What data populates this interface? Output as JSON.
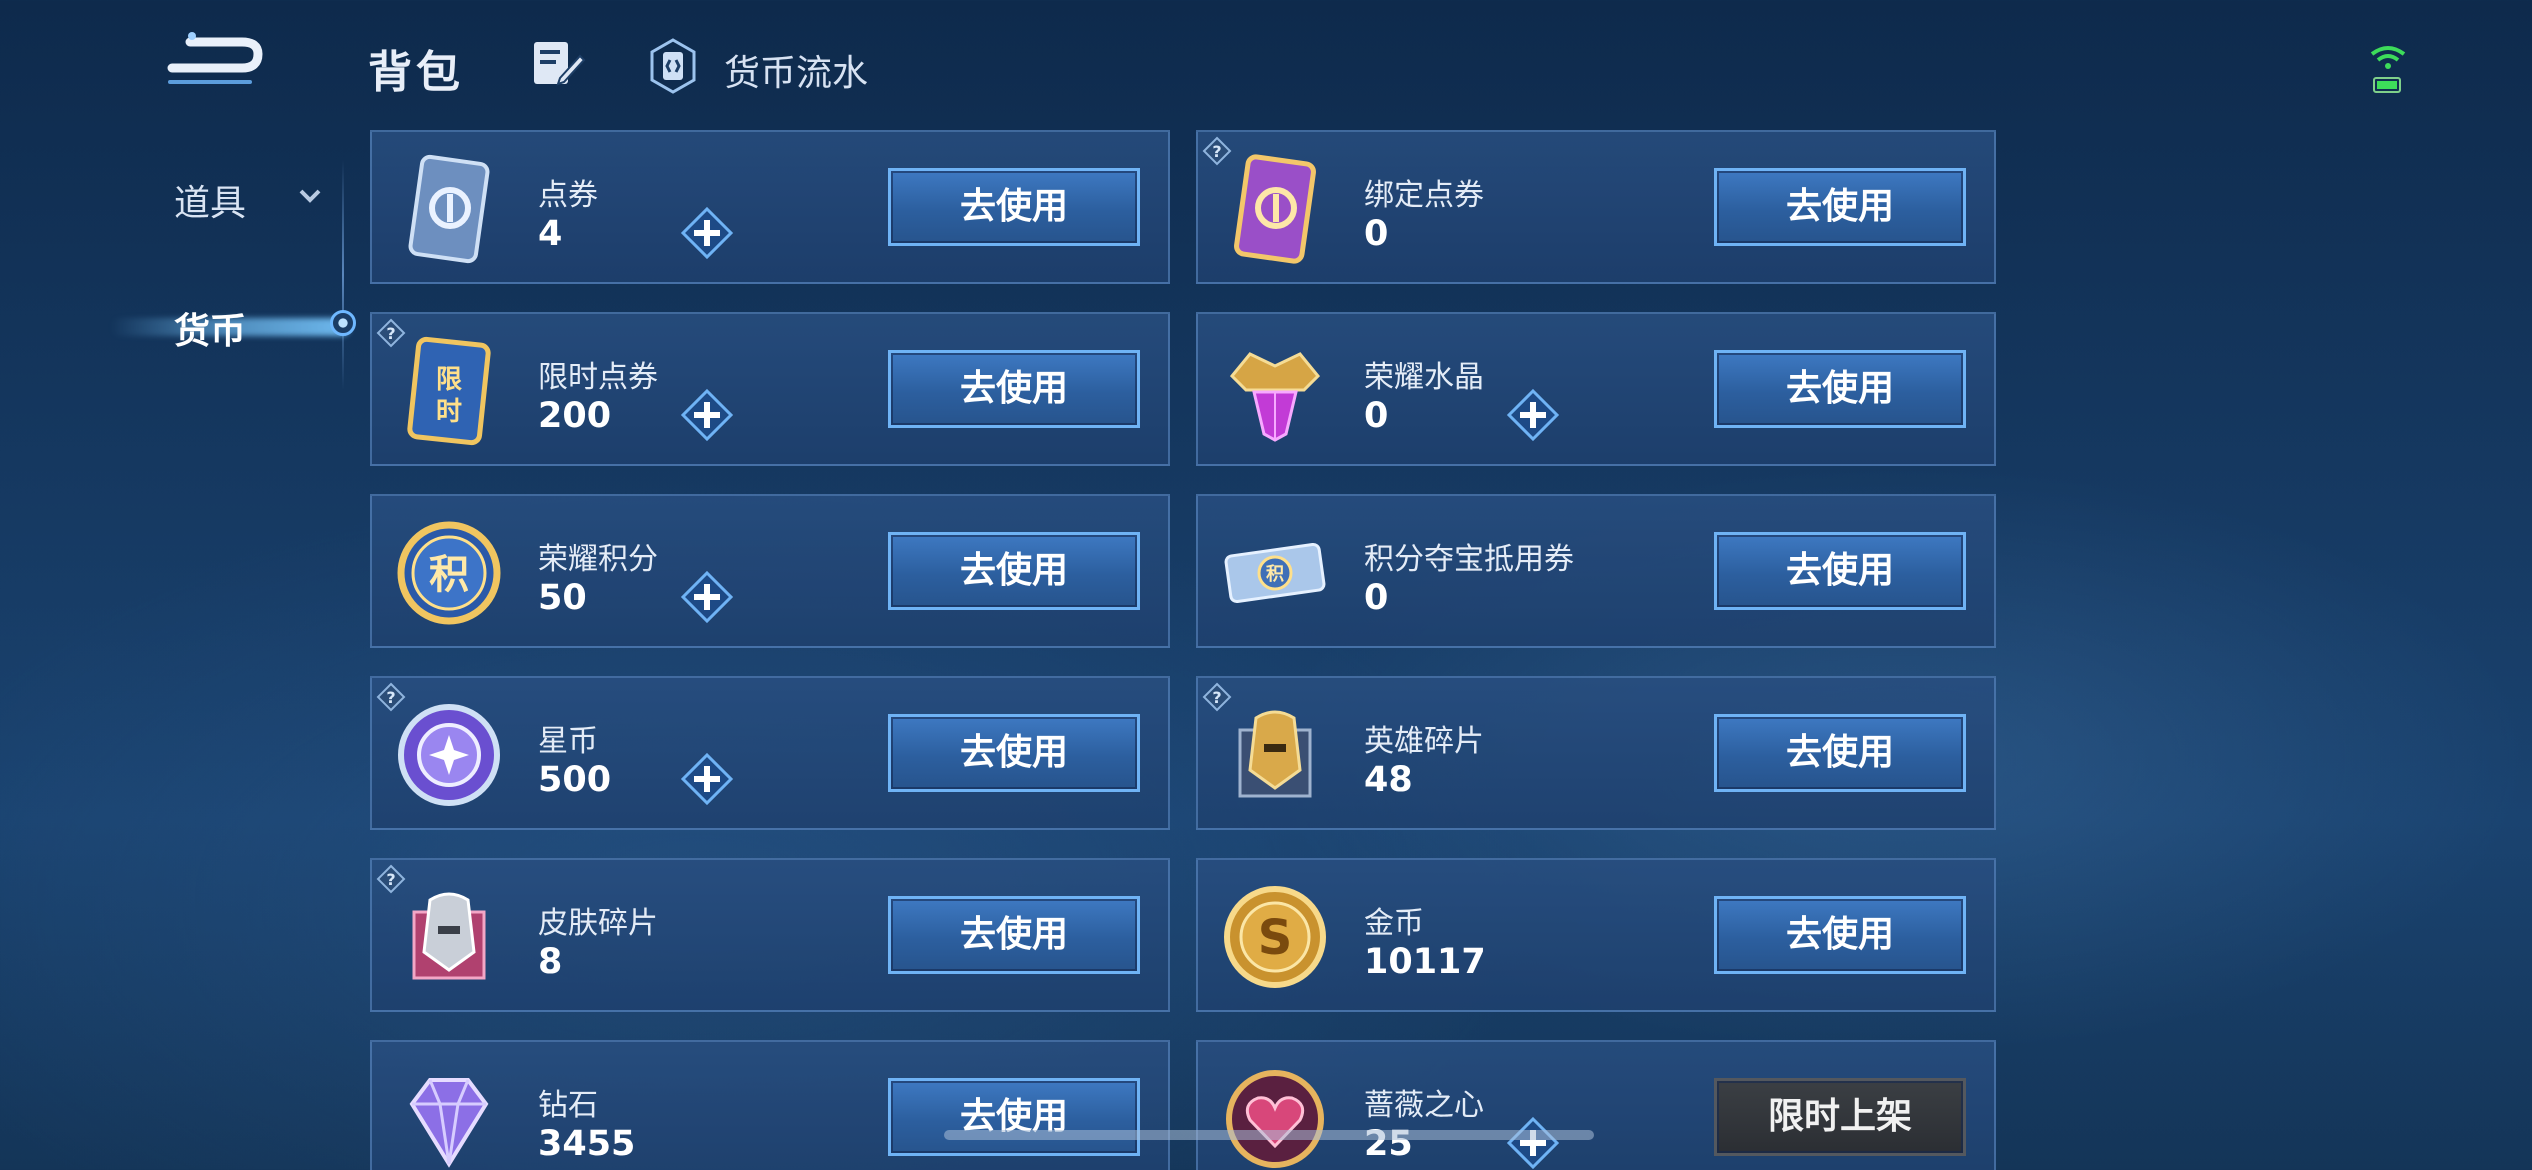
{
  "header": {
    "title": "背包",
    "flow_label": "货币流水"
  },
  "sidebar": {
    "items": [
      {
        "label": "道具"
      },
      {
        "label": "货币"
      }
    ]
  },
  "colors": {
    "accent": "#6fb3f5",
    "button_fill": "#2c5f9f",
    "card_fill": "#244a7c",
    "background": "#163a63"
  },
  "cards": [
    {
      "name": "点券",
      "amount": "4",
      "button": "去使用",
      "icon": "voucher-card-icon"
    },
    {
      "name": "绑定点券",
      "amount": "0",
      "button": "去使用",
      "icon": "bound-voucher-card-icon"
    },
    {
      "name": "限时点券",
      "amount": "200",
      "button": "去使用",
      "icon": "limited-voucher-icon"
    },
    {
      "name": "荣耀水晶",
      "amount": "0",
      "button": "去使用",
      "icon": "glory-crystal-icon"
    },
    {
      "name": "荣耀积分",
      "amount": "50",
      "button": "去使用",
      "icon": "glory-points-icon"
    },
    {
      "name": "积分夺宝抵用券",
      "amount": "0",
      "button": "去使用",
      "icon": "points-ticket-icon"
    },
    {
      "name": "星币",
      "amount": "500",
      "button": "去使用",
      "icon": "star-coin-icon"
    },
    {
      "name": "英雄碎片",
      "amount": "48",
      "button": "去使用",
      "icon": "hero-fragment-icon"
    },
    {
      "name": "皮肤碎片",
      "amount": "8",
      "button": "去使用",
      "icon": "skin-fragment-icon"
    },
    {
      "name": "金币",
      "amount": "10117",
      "button": "去使用",
      "icon": "gold-coin-icon"
    },
    {
      "name": "钻石",
      "amount": "3455",
      "button": "去使用",
      "icon": "diamond-icon"
    },
    {
      "name": "蔷薇之心",
      "amount": "25",
      "button": "限时上架",
      "icon": "rose-heart-icon"
    }
  ]
}
